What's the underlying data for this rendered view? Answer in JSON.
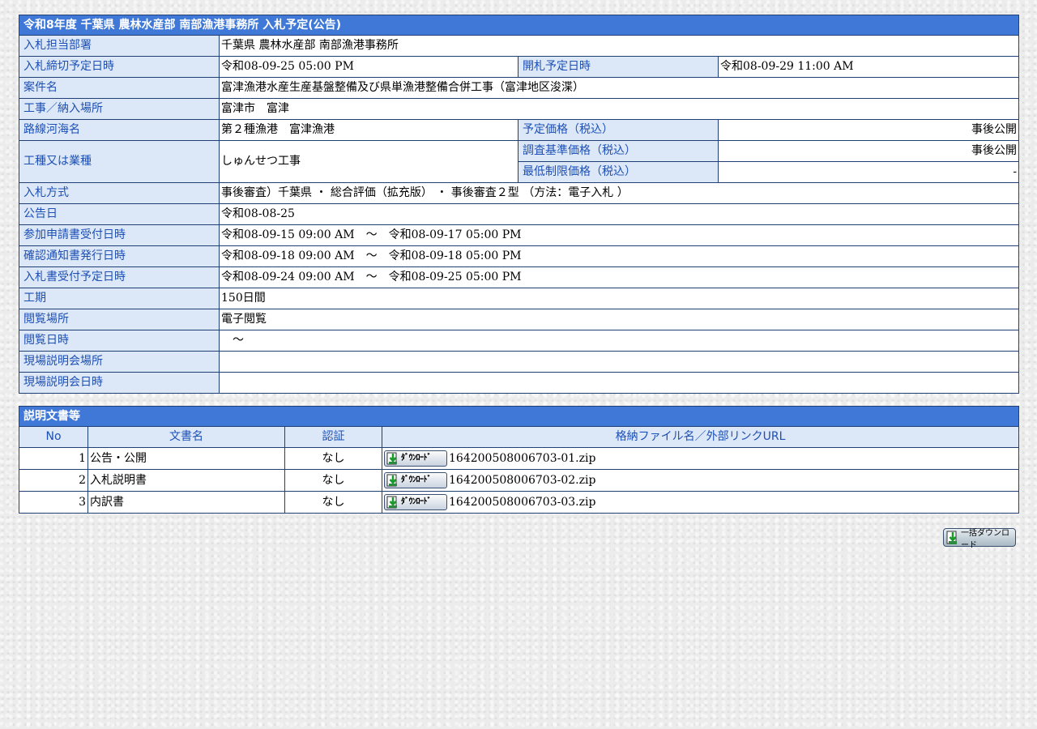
{
  "notice": {
    "title": "令和8年度 千葉県 農林水産部 南部漁港事務所 入札予定(公告)",
    "rows": {
      "dept_label": "入札担当部署",
      "dept_value": "千葉県 農林水産部 南部漁港事務所",
      "deadline_label": "入札締切予定日時",
      "deadline_value": "令和08-09-25 05:00 PM",
      "opening_label": "開札予定日時",
      "opening_value": "令和08-09-29 11:00 AM",
      "case_label": "案件名",
      "case_value": "富津漁港水産生産基盤整備及び県単漁港整備合併工事（富津地区浚渫）",
      "place_label": "工事／納入場所",
      "place_value": "富津市　富津",
      "route_label": "路線河海名",
      "route_value": "第２種漁港　富津漁港",
      "planned_price_label": "予定価格（税込）",
      "planned_price_value": "事後公開",
      "type_label": "工種又は業種",
      "type_value": "しゅんせつ工事",
      "survey_price_label": "調査基準価格（税込）",
      "survey_price_value": "事後公開",
      "min_price_label": "最低制限価格（税込）",
      "min_price_value": "-",
      "method_label": "入札方式",
      "method_value": "事後審査）千葉県 ・ 総合評価（拡充版） ・ 事後審査２型 （方法：電子入札 ）",
      "announce_label": "公告日",
      "announce_value": "令和08-08-25",
      "apply_label": "参加申請書受付日時",
      "apply_value": "令和08-09-15 09:00 AM　～　令和08-09-17 05:00 PM",
      "confirm_label": "確認通知書発行日時",
      "confirm_value": "令和08-09-18 09:00 AM　～　令和08-09-18 05:00 PM",
      "bid_accept_label": "入札書受付予定日時",
      "bid_accept_value": "令和08-09-24 09:00 AM　～　令和08-09-25 05:00 PM",
      "period_label": "工期",
      "period_value": "150日間",
      "view_place_label": "閲覧場所",
      "view_place_value": "電子閲覧",
      "view_date_label": "閲覧日時",
      "view_date_value": "　～",
      "site_place_label": "現場説明会場所",
      "site_place_value": "",
      "site_date_label": "現場説明会日時",
      "site_date_value": ""
    }
  },
  "docs": {
    "title": "説明文書等",
    "headers": {
      "no": "No",
      "name": "文書名",
      "auth": "認証",
      "file": "格納ファイル名／外部リンクURL"
    },
    "items": [
      {
        "no": "1",
        "name": "公告・公開",
        "auth": "なし",
        "file": "164200508006703-01.zip"
      },
      {
        "no": "2",
        "name": "入札説明書",
        "auth": "なし",
        "file": "164200508006703-02.zip"
      },
      {
        "no": "3",
        "name": "内訳書",
        "auth": "なし",
        "file": "164200508006703-03.zip"
      }
    ],
    "download_label": "ﾀﾞｳﾝﾛｰﾄﾞ",
    "bulk_label": "一括ダウンロード"
  }
}
